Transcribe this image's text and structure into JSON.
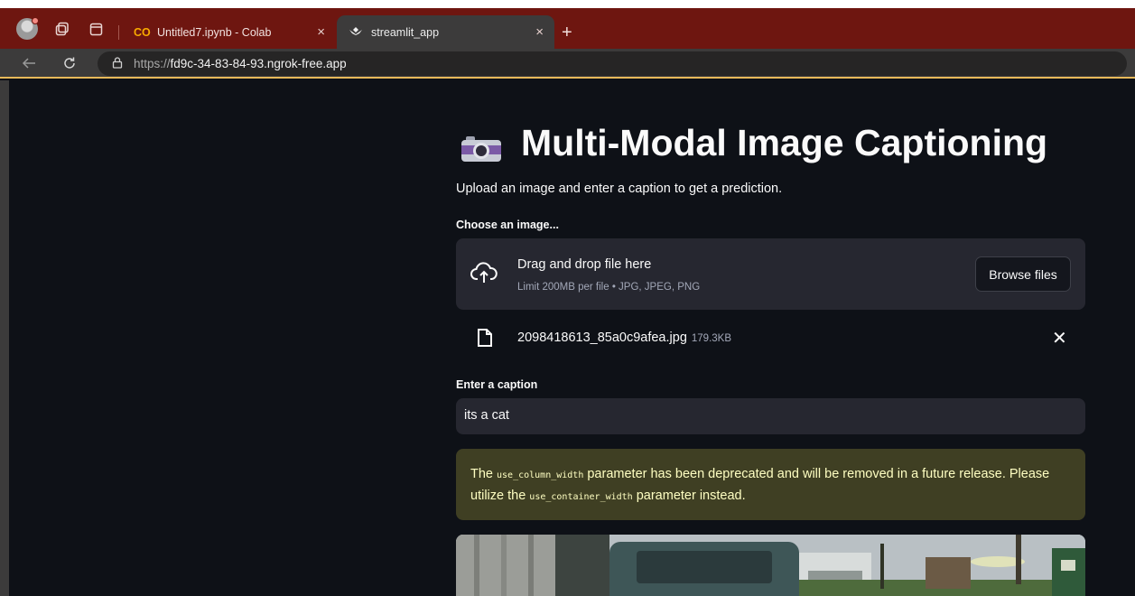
{
  "browser": {
    "tabs": [
      {
        "label": "Untitled7.ipynb - Colab",
        "favicon": "colab-icon",
        "active": false
      },
      {
        "label": "streamlit_app",
        "favicon": "streamlit-icon",
        "active": true
      }
    ],
    "tab_close_glyph": "×",
    "new_tab_glyph": "+",
    "url_scheme": "https://",
    "url_host": "fd9c-34-83-84-93.ngrok-free.app",
    "accent_color": "#6e1610"
  },
  "app": {
    "title": "Multi-Modal Image Captioning",
    "title_icon": "camera-icon",
    "subtitle": "Upload an image and enter a caption to get a prediction.",
    "uploader": {
      "label": "Choose an image...",
      "drag_text": "Drag and drop file here",
      "limit_text": "Limit 200MB per file • JPG, JPEG, PNG",
      "browse_label": "Browse files"
    },
    "uploaded_file": {
      "name": "2098418613_85a0c9afea.jpg",
      "size": "179.3KB",
      "remove_glyph": "✕"
    },
    "caption": {
      "label": "Enter a caption",
      "value": "its a cat"
    },
    "warning": {
      "part1": "The ",
      "code1": "use_column_width",
      "part2": " parameter has been deprecated and will be removed in a future release. Please utilize the ",
      "code2": "use_container_width",
      "part3": " parameter instead."
    },
    "colors": {
      "background": "#0e1117",
      "widget": "#262730",
      "warning_bg": "#3f3f23",
      "warning_text": "#ffffc2"
    }
  }
}
